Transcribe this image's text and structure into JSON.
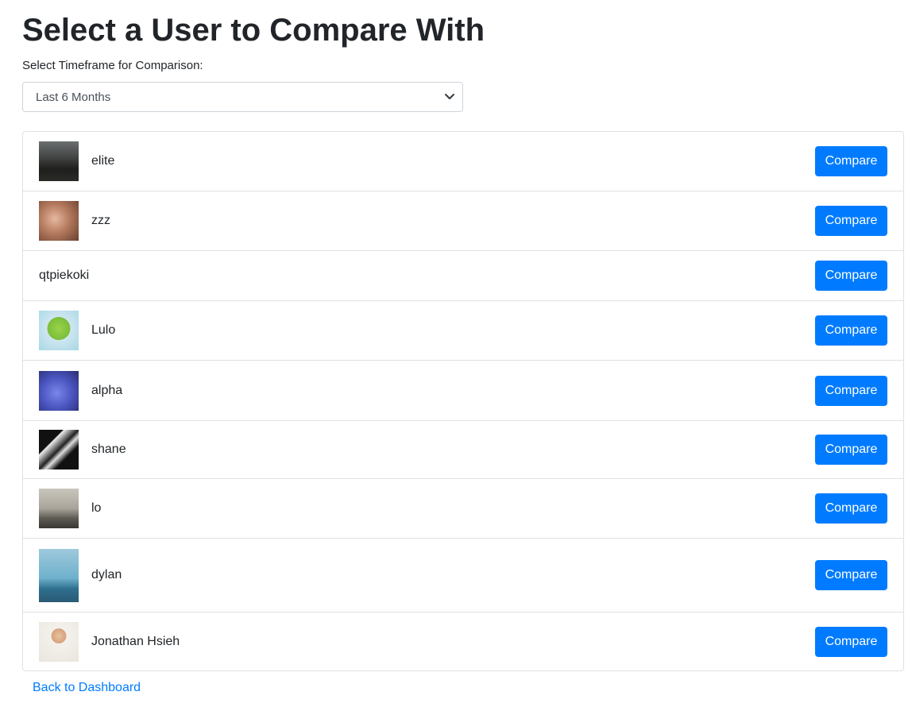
{
  "page_title": "Select a User to Compare With",
  "timeframe": {
    "label": "Select Timeframe for Comparison:",
    "selected": "Last 6 Months"
  },
  "users": [
    {
      "name": "elite",
      "has_avatar": true
    },
    {
      "name": "zzz",
      "has_avatar": true
    },
    {
      "name": "qtpiekoki",
      "has_avatar": false
    },
    {
      "name": "Lulo",
      "has_avatar": true
    },
    {
      "name": "alpha",
      "has_avatar": true
    },
    {
      "name": "shane",
      "has_avatar": true
    },
    {
      "name": "lo",
      "has_avatar": true
    },
    {
      "name": "dylan",
      "has_avatar": true
    },
    {
      "name": "Jonathan Hsieh",
      "has_avatar": true
    }
  ],
  "compare_label": "Compare",
  "back_link": "Back to Dashboard",
  "colors": {
    "primary": "#007bff",
    "text": "#212529",
    "border": "#dee2e6"
  }
}
